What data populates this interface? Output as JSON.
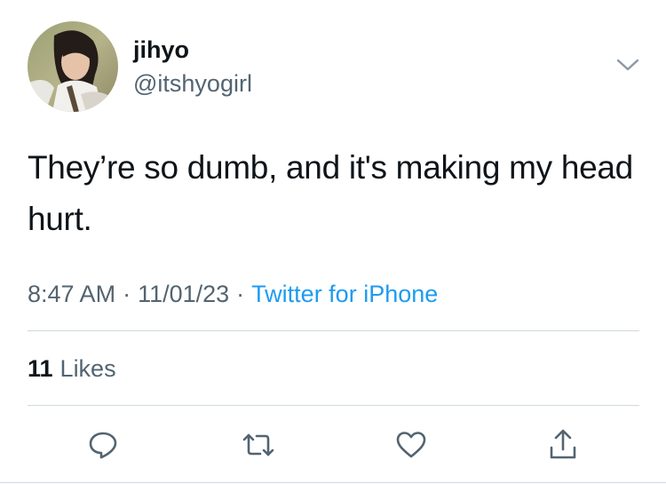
{
  "user": {
    "display_name": "jihyo",
    "handle": "@itshyogirl"
  },
  "tweet": {
    "text": "They’re so dumb, and it's making my head hurt.",
    "time": "8:47 AM",
    "date": "11/01/23",
    "separator": "·",
    "source": "Twitter for iPhone"
  },
  "stats": {
    "likes_count": "11",
    "likes_label": "Likes"
  },
  "icons": {
    "more": "chevron-down-icon",
    "reply": "reply-icon",
    "retweet": "retweet-icon",
    "like": "heart-icon",
    "share": "share-icon"
  },
  "colors": {
    "text_primary": "#0f1419",
    "text_secondary": "#536471",
    "link": "#1d9bf0",
    "divider": "#cfd9de"
  }
}
